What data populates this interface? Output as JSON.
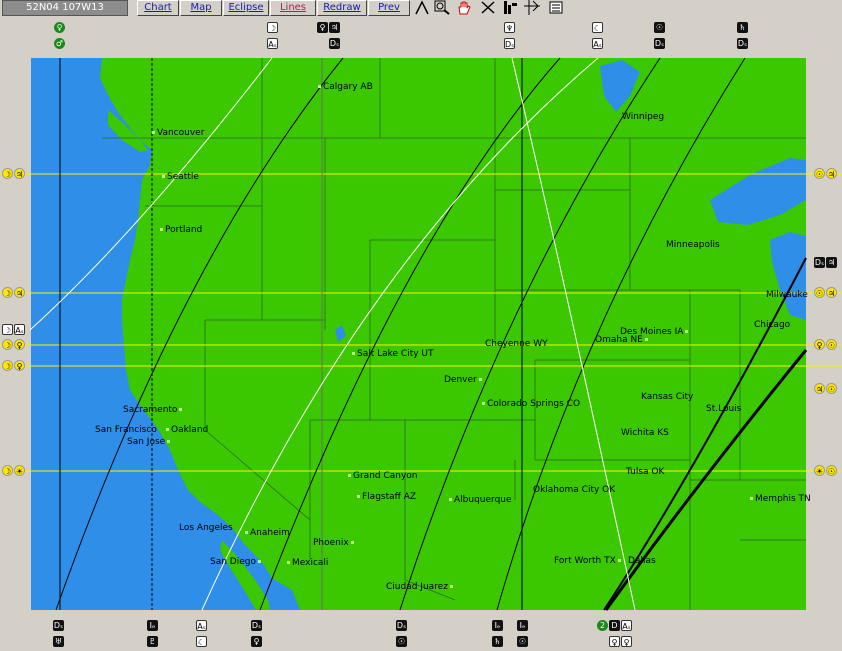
{
  "toolbar": {
    "coords": "52N04  107W13",
    "buttons": [
      "Chart",
      "Map",
      "Eclipse",
      "Lines",
      "Redraw",
      "Prev"
    ],
    "icons": [
      "compass-icon",
      "zoom-icon",
      "hand-icon",
      "lines-cross-icon",
      "tools-icon",
      "grid-icon",
      "print-icon"
    ]
  },
  "colors": {
    "ocean": "#2f8fe8",
    "land": "#3cc800",
    "lake": "#2f8fe8",
    "frame": "#d4d0c8",
    "latitude_line": "#f5f500",
    "line_black": "#000000",
    "line_white": "#ffffff"
  },
  "cities": [
    {
      "name": "Calgary AB"
    },
    {
      "name": "Vancouver"
    },
    {
      "name": "Seattle"
    },
    {
      "name": "Portland"
    },
    {
      "name": "Winnipeg"
    },
    {
      "name": "Minneapolis"
    },
    {
      "name": "Milwauke"
    },
    {
      "name": "Chicago"
    },
    {
      "name": "Des Moines IA"
    },
    {
      "name": "Omaha NE"
    },
    {
      "name": "Cheyenne WY"
    },
    {
      "name": "Salt Lake City UT"
    },
    {
      "name": "Denver"
    },
    {
      "name": "Colorado Springs CO"
    },
    {
      "name": "Kansas City"
    },
    {
      "name": "St.Louis"
    },
    {
      "name": "Wichita KS"
    },
    {
      "name": "Sacramento"
    },
    {
      "name": "San Francisco"
    },
    {
      "name": "Oakland"
    },
    {
      "name": "San Jose"
    },
    {
      "name": "Tulsa OK"
    },
    {
      "name": "Grand Canyon"
    },
    {
      "name": "Flagstaff AZ"
    },
    {
      "name": "Albuquerque"
    },
    {
      "name": "Oklahoma City OK"
    },
    {
      "name": "Memphis TN"
    },
    {
      "name": "Los Angeles"
    },
    {
      "name": "Anaheim"
    },
    {
      "name": "Phoenix"
    },
    {
      "name": "San Diego"
    },
    {
      "name": "Mexicali"
    },
    {
      "name": "Fort Worth TX"
    },
    {
      "name": "Dallas"
    },
    {
      "name": "Ciudad Juarez"
    }
  ],
  "planet_glyphs": {
    "top": [
      "♀",
      "♂",
      "☽",
      "Aₛ",
      "♀",
      "♃",
      "Dₛ",
      "♆",
      "Dₛ",
      "☾",
      "Aₛ",
      "☉",
      "Dₛ",
      "♄",
      "Dₛ"
    ],
    "bottom": [
      "Dₛ",
      "♅",
      "Iₑ",
      "♇",
      "Aₛ",
      "☾",
      "Dₛ",
      "♀",
      "Dₛ",
      "☉",
      "Iₑ",
      "♄",
      "Iₑ",
      "☉",
      "2",
      "D",
      "Aₛ",
      "♀",
      "♀"
    ],
    "left": [
      "☽",
      "♃",
      "☽",
      "♃",
      "☽",
      "Aₛ",
      "☽",
      "♀",
      "☽",
      "♀",
      "☽",
      "☀"
    ],
    "right": [
      "☉",
      "♃",
      "Dₛ",
      "♃",
      "☉",
      "♃",
      "♀",
      "☉",
      "♃",
      "☉",
      "☀",
      "☉"
    ]
  }
}
